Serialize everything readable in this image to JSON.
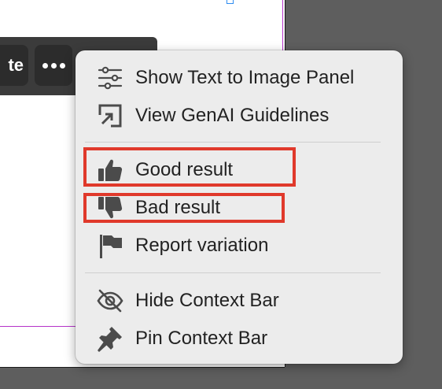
{
  "context_bar": {
    "partial_button_label": "te",
    "more_button_icon": "more-horizontal-icon"
  },
  "menu": {
    "items": [
      {
        "label": "Show Text to Image Panel",
        "icon": "sliders-icon"
      },
      {
        "label": "View GenAI Guidelines",
        "icon": "open-external-icon"
      },
      {
        "label": "Good result",
        "icon": "thumbs-up-icon"
      },
      {
        "label": "Bad result",
        "icon": "thumbs-down-icon"
      },
      {
        "label": "Report variation",
        "icon": "flag-icon"
      },
      {
        "label": "Hide Context Bar",
        "icon": "eye-off-icon"
      },
      {
        "label": "Pin Context Bar",
        "icon": "pin-icon"
      }
    ]
  },
  "colors": {
    "highlight": "#e0392b",
    "menu_background": "#ececec",
    "icon": "#4b4b4b",
    "artboard_edge": "#b533c9"
  }
}
